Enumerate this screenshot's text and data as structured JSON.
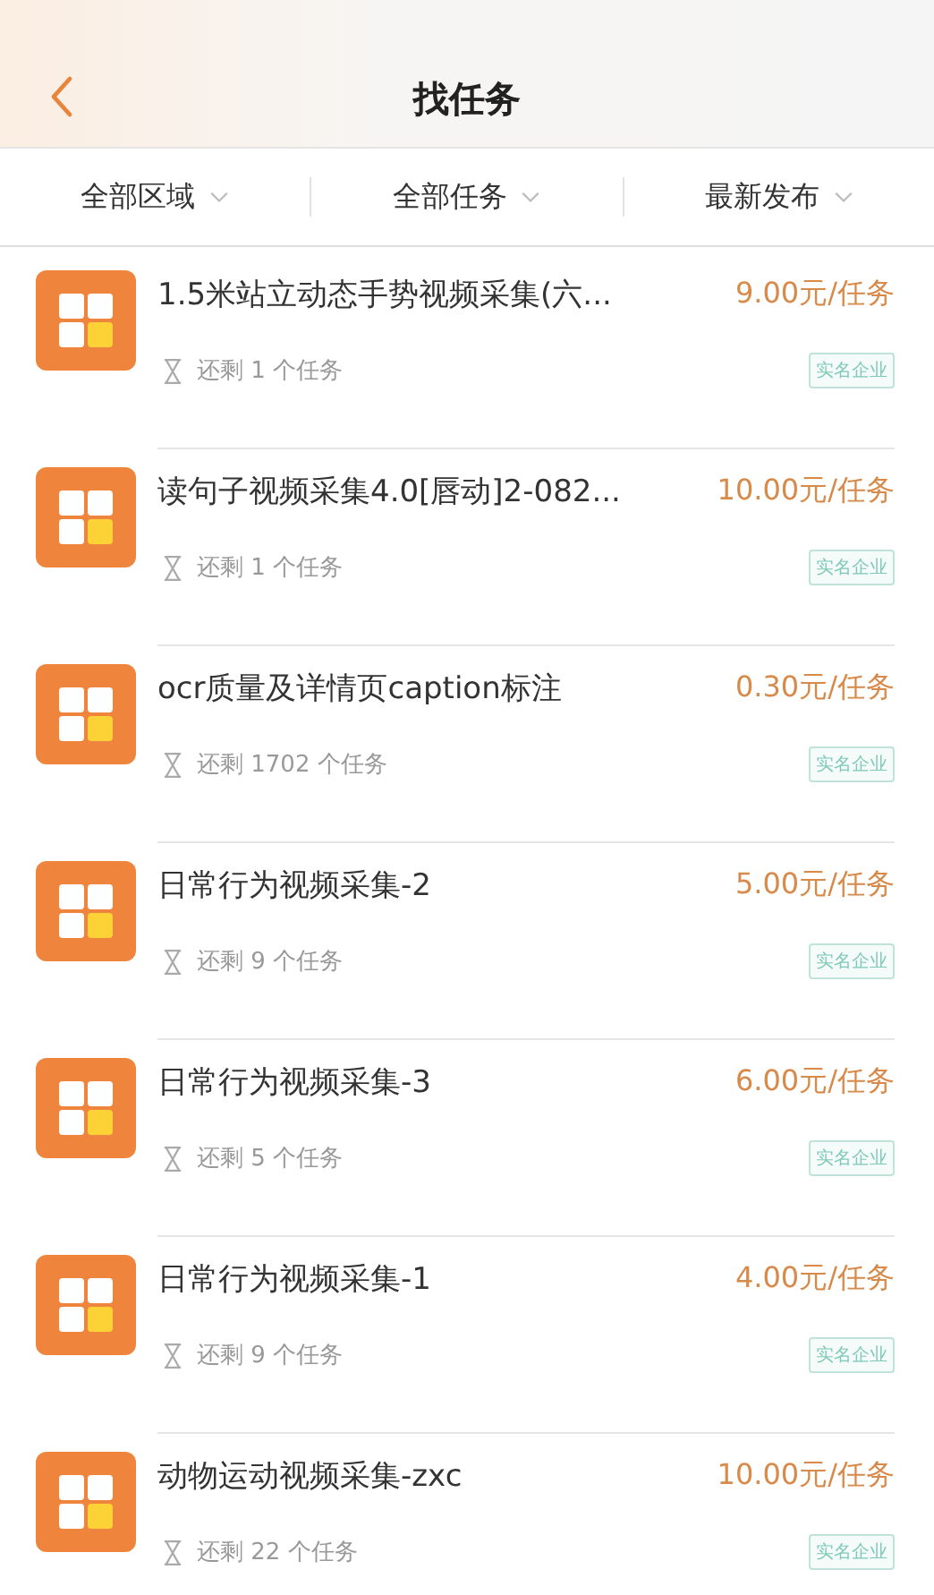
{
  "header": {
    "title": "找任务"
  },
  "filters": [
    {
      "label": "全部区域"
    },
    {
      "label": "全部任务"
    },
    {
      "label": "最新发布"
    }
  ],
  "tasks": [
    {
      "title": "1.5米站立动态手势视频采集(六...",
      "price": "9.00元/任务",
      "remaining": "还剩 1 个任务",
      "badge": "实名企业"
    },
    {
      "title": "读句子视频采集4.0[唇动]2-082...",
      "price": "10.00元/任务",
      "remaining": "还剩 1 个任务",
      "badge": "实名企业"
    },
    {
      "title": "ocr质量及详情页caption标注",
      "price": "0.30元/任务",
      "remaining": "还剩 1702 个任务",
      "badge": "实名企业"
    },
    {
      "title": "日常行为视频采集-2",
      "price": "5.00元/任务",
      "remaining": "还剩 9 个任务",
      "badge": "实名企业"
    },
    {
      "title": "日常行为视频采集-3",
      "price": "6.00元/任务",
      "remaining": "还剩 5 个任务",
      "badge": "实名企业"
    },
    {
      "title": "日常行为视频采集-1",
      "price": "4.00元/任务",
      "remaining": "还剩 9 个任务",
      "badge": "实名企业"
    },
    {
      "title": "动物运动视频采集-zxc",
      "price": "10.00元/任务",
      "remaining": "还剩 22 个任务",
      "badge": "实名企业"
    }
  ]
}
